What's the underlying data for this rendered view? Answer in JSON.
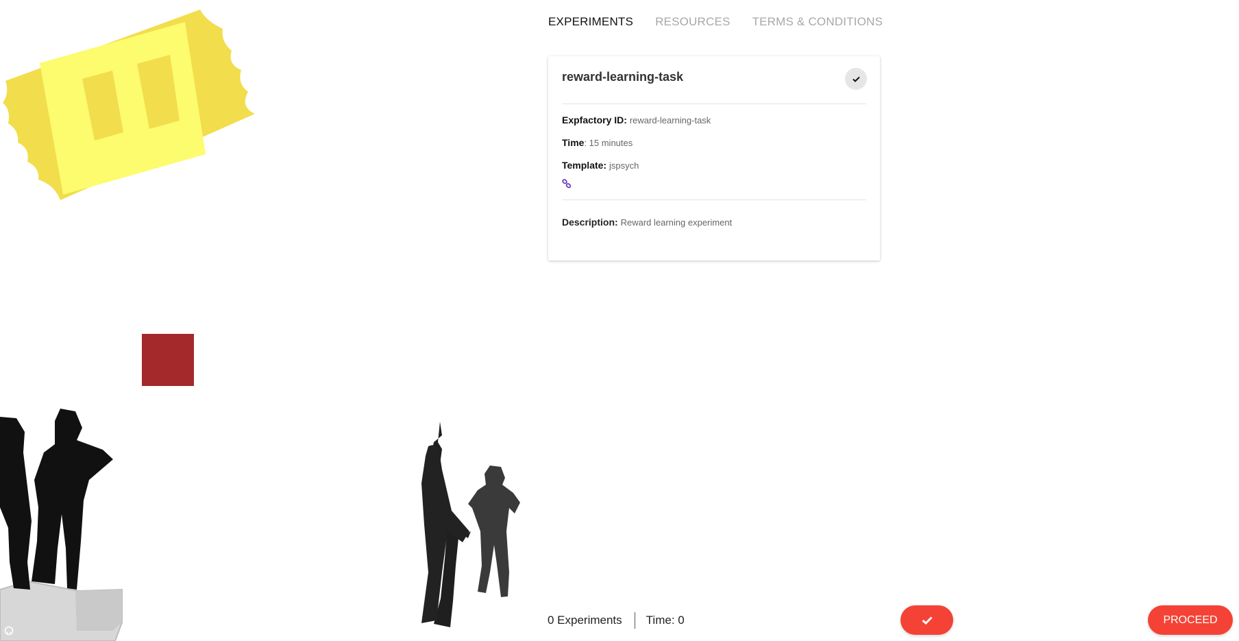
{
  "nav": {
    "tabs": [
      {
        "label": "EXPERIMENTS",
        "active": true
      },
      {
        "label": "RESOURCES",
        "active": false
      },
      {
        "label": "TERMS & CONDITIONS",
        "active": false
      }
    ]
  },
  "experiment": {
    "title": "reward-learning-task",
    "expfactory_label": "Expfactory ID:",
    "expfactory_id": "reward-learning-task",
    "time_label": "Time",
    "time_value": ": 15 minutes",
    "template_label": "Template:",
    "template_value": "jspsych",
    "description_label": "Description:",
    "description_value": "Reward learning experiment"
  },
  "footer": {
    "experiments_count": "0 Experiments",
    "time_total": "Time: 0",
    "proceed_label": "PROCEED"
  },
  "icons": {
    "selected_check": "check-icon",
    "link": "link-icon",
    "github": "github-icon"
  },
  "colors": {
    "accent": "#f44336",
    "ticket_outer": "#f2dd4c",
    "ticket_inner": "#fdfb6e",
    "red_square": "#a3292a",
    "link": "#6a3fb8"
  }
}
